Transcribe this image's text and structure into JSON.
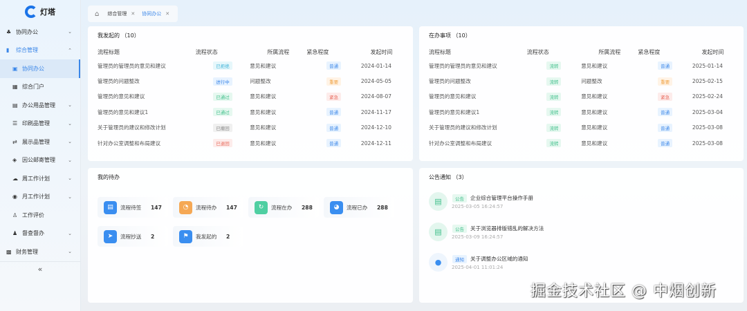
{
  "app": {
    "name": "灯塔"
  },
  "sidebar": {
    "items": [
      {
        "label": "协同办公",
        "icon": "cluster-icon",
        "chev": "⌄"
      },
      {
        "label": "综合管理",
        "icon": "panel-icon",
        "chev": "⌃"
      },
      {
        "label": "协同办公",
        "icon": "doc-icon"
      },
      {
        "label": "综合门户",
        "icon": "grid-icon"
      },
      {
        "label": "办公用品管理",
        "icon": "book-icon",
        "chev": "⌄"
      },
      {
        "label": "印刷品管理",
        "icon": "list-icon",
        "chev": "⌄"
      },
      {
        "label": "展示品管理",
        "icon": "swap-icon",
        "chev": "⌄"
      },
      {
        "label": "因公邮寄管理",
        "icon": "shield-icon",
        "chev": "⌄"
      },
      {
        "label": "周工作计划",
        "icon": "upload-cloud-icon",
        "chev": "⌄"
      },
      {
        "label": "月工作计划",
        "icon": "eye-icon",
        "chev": "⌄"
      },
      {
        "label": "工作评价",
        "icon": "user-icon"
      },
      {
        "label": "督查督办",
        "icon": "user-add-icon",
        "chev": "⌄"
      },
      {
        "label": "财务管理",
        "icon": "wallet-icon",
        "chev": "⌄"
      }
    ],
    "collapse": "«"
  },
  "tabs": [
    {
      "label": "综合管理"
    },
    {
      "label": "协同办公"
    }
  ],
  "columns": [
    "流程标题",
    "流程状态",
    "所属流程",
    "紧急程度",
    "发起时间"
  ],
  "initiated": {
    "title": "我发起的 （10）",
    "rows": [
      {
        "title": "管理员的管理员的意见和建议",
        "status": "已拒绝",
        "sc": "cyan",
        "flow": "意见和建议",
        "urg": "普通",
        "uc": "blue",
        "date": "2024-01-14"
      },
      {
        "title": "管理员的问题整改",
        "status": "进行中",
        "sc": "blue",
        "flow": "问题整改",
        "urg": "重要",
        "uc": "orange",
        "date": "2024-05-05"
      },
      {
        "title": "管理员的意见和建议",
        "status": "已通过",
        "sc": "green",
        "flow": "意见和建议",
        "urg": "紧急",
        "uc": "red",
        "date": "2024-08-07"
      },
      {
        "title": "管理员的意见和建议1",
        "status": "已通过",
        "sc": "green",
        "flow": "意见和建议",
        "urg": "普通",
        "uc": "blue",
        "date": "2024-11-17"
      },
      {
        "title": "关于管理员的建议和修改计划",
        "status": "已撤回",
        "sc": "gray",
        "flow": "意见和建议",
        "urg": "普通",
        "uc": "blue",
        "date": "2024-12-10"
      },
      {
        "title": "针对办公室调整和布局建议",
        "status": "已退回",
        "sc": "red",
        "flow": "意见和建议",
        "urg": "普通",
        "uc": "blue",
        "date": "2024-12-11"
      }
    ]
  },
  "inprogress": {
    "title": "在办事项 （10）",
    "rows": [
      {
        "title": "管理员的管理员的意见和建议",
        "status": "流转",
        "sc": "green",
        "flow": "意见和建议",
        "urg": "普通",
        "uc": "blue",
        "date": "2025-01-14"
      },
      {
        "title": "管理员的问题整改",
        "status": "流转",
        "sc": "green",
        "flow": "问题整改",
        "urg": "重要",
        "uc": "orange",
        "date": "2025-02-15"
      },
      {
        "title": "管理员的意见和建议",
        "status": "流转",
        "sc": "green",
        "flow": "意见和建议",
        "urg": "紧急",
        "uc": "red",
        "date": "2025-02-24"
      },
      {
        "title": "管理员的意见和建议1",
        "status": "流转",
        "sc": "green",
        "flow": "意见和建议",
        "urg": "普通",
        "uc": "blue",
        "date": "2025-03-04"
      },
      {
        "title": "关于管理员的建议和修改计划",
        "status": "流转",
        "sc": "green",
        "flow": "意见和建议",
        "urg": "普通",
        "uc": "blue",
        "date": "2025-03-08"
      },
      {
        "title": "针对办公室调整和布局建议",
        "status": "流转",
        "sc": "green",
        "flow": "意见和建议",
        "urg": "普通",
        "uc": "blue",
        "date": "2025-03-08"
      }
    ]
  },
  "todo": {
    "title": "我的待办",
    "tiles": [
      {
        "label": "流程待签",
        "count": "147",
        "color": "#3a8ef0",
        "icon": "sign-doc-icon"
      },
      {
        "label": "流程待办",
        "count": "147",
        "color": "#f5a855",
        "icon": "clock-icon"
      },
      {
        "label": "流程在办",
        "count": "288",
        "color": "#4fcfa2",
        "icon": "refresh-icon"
      },
      {
        "label": "流程已办",
        "count": "288",
        "color": "#3a8ef0",
        "icon": "check-clock-icon"
      },
      {
        "label": "流程抄送",
        "count": "2",
        "color": "#3a8ef0",
        "icon": "send-icon"
      },
      {
        "label": "我发起的",
        "count": "2",
        "color": "#3a8ef0",
        "icon": "flag-icon"
      }
    ]
  },
  "notices": {
    "title": "公告通知 （3）",
    "items": [
      {
        "tag": "公告",
        "title": "企业综合管理平台操作手册",
        "date": "2025-03-05 16:24:57",
        "kind": "announce"
      },
      {
        "tag": "公告",
        "title": "关于浏览器排版错乱的解决方法",
        "date": "2025-03-09 16:24:57",
        "kind": "announce"
      },
      {
        "tag": "通知",
        "title": "关于调整办公区域的通知",
        "date": "2025-04-01 11:01:24",
        "kind": "notice"
      }
    ]
  },
  "watermark": "掘金技术社区 @ 中烟创新"
}
